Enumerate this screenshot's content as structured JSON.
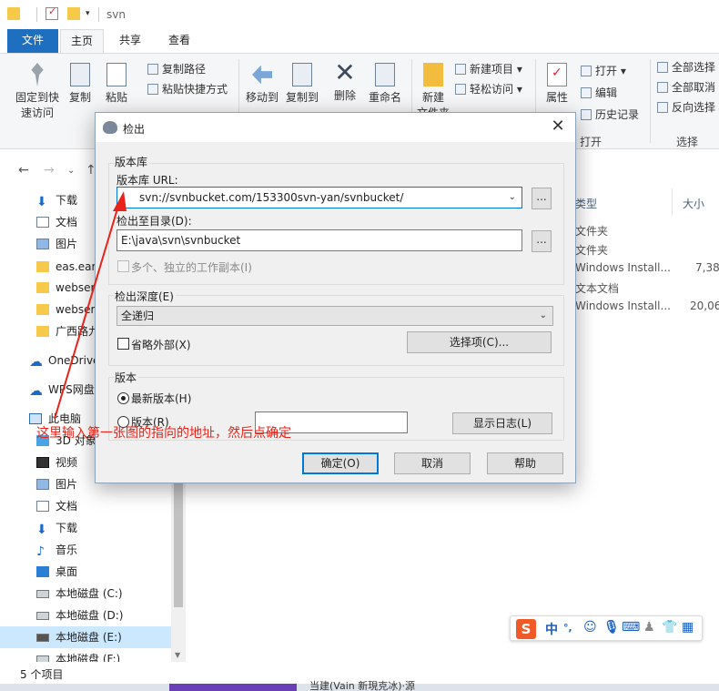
{
  "window": {
    "title": "svn"
  },
  "tabs": {
    "file": "文件",
    "home": "主页",
    "share": "共享",
    "view": "查看"
  },
  "ribbon": {
    "pin": "固定到快速访问",
    "pin_l1": "固定到快",
    "pin_l2": "速访问",
    "copy": "复制",
    "paste": "粘贴",
    "copy_path": "复制路径",
    "paste_shortcut": "粘贴快捷方式",
    "move_to": "移动到",
    "copy_to": "复制到",
    "delete": "删除",
    "rename": "重命名",
    "new_folder": "新建",
    "new_folder_l2": "文件夹",
    "new_item": "新建项目",
    "easy_access": "轻松访问",
    "properties": "属性",
    "open": "打开",
    "edit": "编辑",
    "history": "历史记录",
    "group_open": "打开",
    "select_all": "全部选择",
    "select_none": "全部取消",
    "invert_select": "反向选择",
    "group_select": "选择"
  },
  "sidebar": {
    "items": [
      {
        "label": "下载",
        "icon": "download-icon"
      },
      {
        "label": "文档",
        "icon": "documents-icon"
      },
      {
        "label": "图片",
        "icon": "pictures-icon"
      },
      {
        "label": "eas.ear",
        "icon": "folder-icon"
      },
      {
        "label": "webser",
        "icon": "folder-icon"
      },
      {
        "label": "webser",
        "icon": "folder-icon"
      },
      {
        "label": "广西路九",
        "icon": "folder-icon"
      },
      {
        "label": "OneDrive",
        "icon": "onedrive-icon"
      },
      {
        "label": "WPS网盘",
        "icon": "wps-cloud-icon"
      },
      {
        "label": "此电脑",
        "icon": "this-pc-icon"
      },
      {
        "label": "3D 对象",
        "icon": "3d-objects-icon"
      },
      {
        "label": "视频",
        "icon": "videos-icon"
      },
      {
        "label": "图片",
        "icon": "pictures-icon"
      },
      {
        "label": "文档",
        "icon": "documents-icon"
      },
      {
        "label": "下载",
        "icon": "download-icon"
      },
      {
        "label": "音乐",
        "icon": "music-icon"
      },
      {
        "label": "桌面",
        "icon": "desktop-icon"
      },
      {
        "label": "本地磁盘 (C:)",
        "icon": "drive-icon"
      },
      {
        "label": "本地磁盘 (D:)",
        "icon": "drive-icon"
      },
      {
        "label": "本地磁盘 (E:)",
        "icon": "drive-icon"
      },
      {
        "label": "本地磁盘 (F:)",
        "icon": "drive-icon"
      }
    ]
  },
  "files": {
    "col_type": "类型",
    "col_size": "大小",
    "rows": [
      {
        "type": "文件夹",
        "size": ""
      },
      {
        "type": "文件夹",
        "size": ""
      },
      {
        "type": "Windows Install...",
        "size": "7,38"
      },
      {
        "type": "文本文档",
        "size": ""
      },
      {
        "type": "Windows Install...",
        "size": "20,06"
      }
    ]
  },
  "status": {
    "count": "5 个项目"
  },
  "taskbar": {
    "tail_text": "当建(Vain 新現克冰)·源"
  },
  "dialog": {
    "title": "检出",
    "repo_group": "版本库",
    "url_label": "版本库 URL:",
    "url_value": "svn://svnbucket.com/153300svn-yan/svnbucket/",
    "checkout_dir_label": "检出至目录(D):",
    "checkout_dir_value": "E:\\java\\svn\\svnbucket",
    "browse": "...",
    "multi_copy_label": "多个、独立的工作副本(I)",
    "depth_group": "检出深度(E)",
    "depth_value": "全递归",
    "omit_externals": "省略外部(X)",
    "choose_items": "选择项(C)...",
    "revision_group": "版本",
    "head_revision": "最新版本(H)",
    "revision": "版本(R)",
    "show_log": "显示日志(L)",
    "ok": "确定(O)",
    "cancel": "取消",
    "help": "帮助"
  },
  "annotation": {
    "text": "这里输入第一张图的指向的地址，然后点确定",
    "color": "#e8231a"
  },
  "ime": {
    "lang": "中",
    "punct": "°,"
  }
}
